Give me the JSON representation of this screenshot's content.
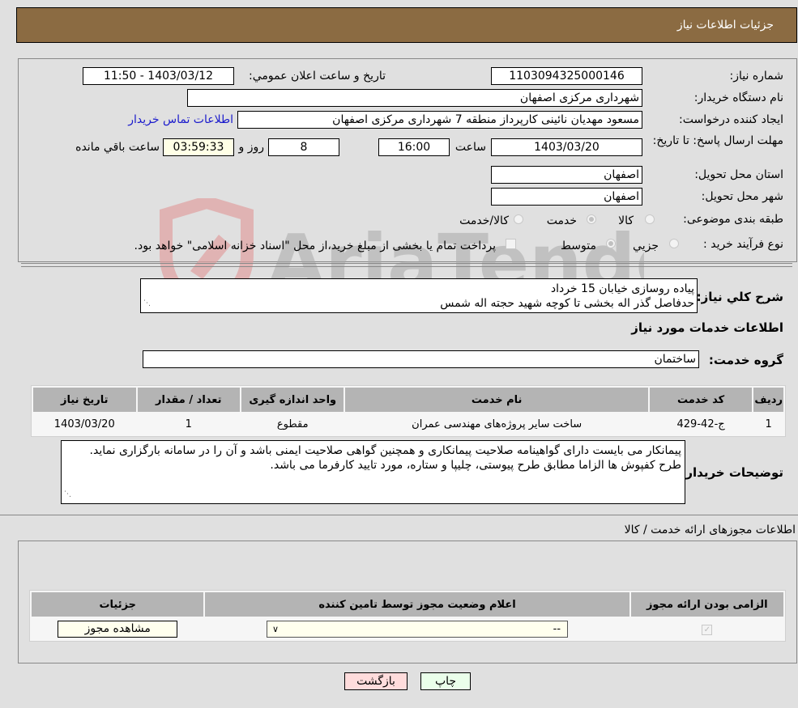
{
  "header": {
    "title": "جزئیات اطلاعات نیاز"
  },
  "form": {
    "need_number": {
      "label": "شماره نیاز:",
      "value": "1103094325000146"
    },
    "announce_datetime": {
      "label": "تاریخ و ساعت اعلان عمومي:",
      "value": "1403/03/12 - 11:50"
    },
    "buyer_org": {
      "label": "نام دستگاه خریدار:",
      "value": "شهرداری مرکزی اصفهان"
    },
    "requester": {
      "label": "ایجاد کننده درخواست:",
      "value": "مسعود مهدیان نائینی کارپرداز منطقه 7 شهرداری مرکزی اصفهان",
      "contact_link": "اطلاعات تماس خریدار"
    },
    "deadline": {
      "label": "مهلت ارسال پاسخ: تا تاریخ:",
      "date": "1403/03/20",
      "time_label": "ساعت",
      "time": "16:00",
      "days": "8",
      "days_label": "روز و",
      "remaining": "03:59:33",
      "remaining_label": "ساعت باقي مانده"
    },
    "province": {
      "label": "استان محل تحویل:",
      "value": "اصفهان"
    },
    "city": {
      "label": "شهر محل تحویل:",
      "value": "اصفهان"
    },
    "category": {
      "label": "طبقه بندی موضوعی:",
      "options": [
        "کالا",
        "خدمت",
        "کالا/خدمت"
      ],
      "selected": "خدمت"
    },
    "purchase_type": {
      "label": "نوع فرآیند خرید :",
      "options": [
        "جزيي",
        "متوسط"
      ],
      "selected": "متوسط",
      "treasury_note": "پرداخت تمام یا بخشی از مبلغ خرید،از محل \"اسناد خزانه اسلامی\" خواهد بود."
    },
    "description": {
      "label": "شرح كلي نياز:",
      "lines": [
        "پیاده روسازی خیابان 15 خرداد",
        "حدفاصل گذر اله بخشی تا کوچه شهید حجته اله شمس"
      ]
    }
  },
  "services": {
    "section_title": "اطلاعات خدمات مورد نیاز",
    "group_label": "گروه خدمت:",
    "group_value": "ساختمان",
    "table": {
      "headers": [
        "ردیف",
        "کد خدمت",
        "نام خدمت",
        "واحد اندازه گیری",
        "تعداد / مقدار",
        "تاریخ نیاز"
      ],
      "rows": [
        [
          "1",
          "ج-42-429",
          "ساخت سایر پروژه‌های مهندسی عمران",
          "مقطوع",
          "1",
          "1403/03/20"
        ]
      ]
    }
  },
  "buyer_notes": {
    "label": "توضیحات خریدار:",
    "text": "پیمانکار می بایست دارای گواهینامه صلاحیت پیمانکاری و همچنین گواهی صلاحیت ایمنی باشد و آن را در سامانه بارگزاری نماید. طرح کفپوش ها الزاما مطابق طرح پیوستی، چلیپا و ستاره، مورد تایید کارفرما می باشد."
  },
  "permits": {
    "section_title": "اطلاعات مجوزهای ارائه خدمت / کالا",
    "headers": [
      "الزامی بودن ارائه مجوز",
      "اعلام وضعیت مجوز توسط تامین کننده",
      "جزئیات"
    ],
    "row": {
      "required_checked": true,
      "status_value": "--",
      "details_button": "مشاهده مجوز"
    }
  },
  "actions": {
    "print": "چاپ",
    "back": "بازگشت"
  },
  "watermark": {
    "text": "AriaTender.neT"
  },
  "colors": {
    "header_bg": "#8b6b42",
    "back_btn": "#ffdcdc",
    "print_btn": "#eaffea",
    "link": "#1a1acc"
  }
}
